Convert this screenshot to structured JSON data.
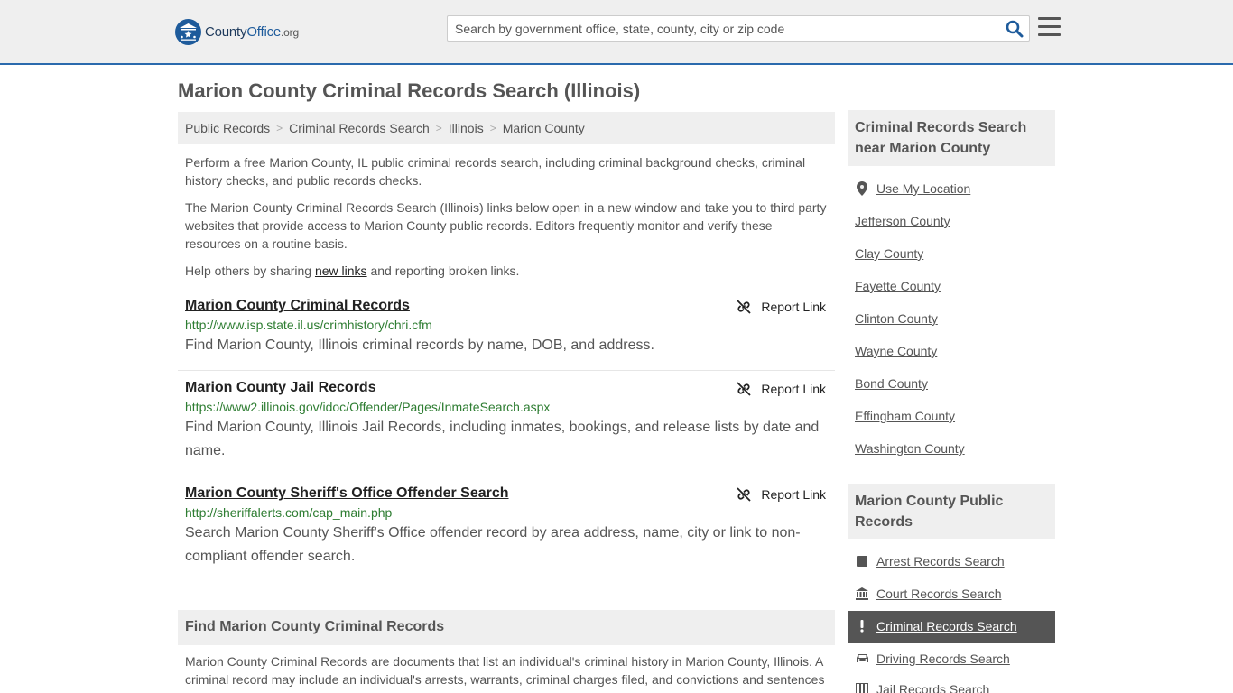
{
  "header": {
    "logo_county": "County",
    "logo_office": "Office",
    "logo_org": ".org",
    "search_placeholder": "Search by government office, state, county, city or zip code"
  },
  "page_title": "Marion County Criminal Records Search (Illinois)",
  "breadcrumb": [
    "Public Records",
    "Criminal Records Search",
    "Illinois",
    "Marion County"
  ],
  "intro": {
    "p1": "Perform a free Marion County, IL public criminal records search, including criminal background checks, criminal history checks, and public records checks.",
    "p2": "The Marion County Criminal Records Search (Illinois) links below open in a new window and take you to third party websites that provide access to Marion County public records. Editors frequently monitor and verify these resources on a routine basis.",
    "p3_before": "Help others by sharing ",
    "p3_link": "new links",
    "p3_after": " and reporting broken links."
  },
  "report_label": "Report Link",
  "entries": [
    {
      "title": "Marion County Criminal Records",
      "url": "http://www.isp.state.il.us/crimhistory/chri.cfm",
      "desc": "Find Marion County, Illinois criminal records by name, DOB, and address."
    },
    {
      "title": "Marion County Jail Records",
      "url": "https://www2.illinois.gov/idoc/Offender/Pages/InmateSearch.aspx",
      "desc": "Find Marion County, Illinois Jail Records, including inmates, bookings, and release lists by date and name."
    },
    {
      "title": "Marion County Sheriff's Office Offender Search",
      "url": "http://sheriffalerts.com/cap_main.php",
      "desc": "Search Marion County Sheriff's Office offender record by area address, name, city or link to non-compliant offender search."
    }
  ],
  "find_section": {
    "heading": "Find Marion County Criminal Records",
    "text": "Marion County Criminal Records are documents that list an individual's criminal history in Marion County, Illinois. A criminal record may include an individual's arrests, warrants, criminal charges filed, and convictions and sentences"
  },
  "sidebar": {
    "nearby_heading": "Criminal Records Search near Marion County",
    "use_location": "Use My Location",
    "nearby": [
      "Jefferson County",
      "Clay County",
      "Fayette County",
      "Clinton County",
      "Wayne County",
      "Bond County",
      "Effingham County",
      "Washington County"
    ],
    "public_heading": "Marion County Public Records",
    "public_links": [
      {
        "label": "Arrest Records Search",
        "icon": "square-icon"
      },
      {
        "label": "Court Records Search",
        "icon": "courthouse-icon"
      },
      {
        "label": "Criminal Records Search",
        "icon": "exclamation-icon"
      },
      {
        "label": "Driving Records Search",
        "icon": "car-icon"
      },
      {
        "label": "Jail Records Search",
        "icon": "jail-icon"
      }
    ]
  },
  "colors": {
    "header_bg": "#efefef",
    "header_border": "#2b6aad",
    "url_green": "#2e7d32",
    "active_bg": "#555555"
  }
}
